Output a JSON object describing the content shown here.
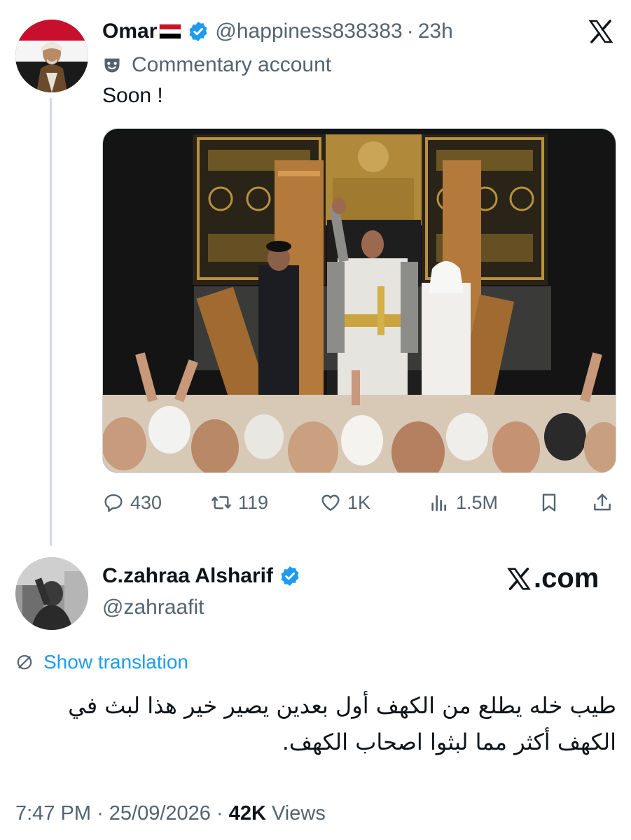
{
  "tweet1": {
    "display_name": "Omar",
    "handle": "@happiness838383",
    "time": "23h",
    "label": "Commentary account",
    "text": "Soon !",
    "flag_icon": "yemen-flag-icon",
    "stats": {
      "replies": "430",
      "reposts": "119",
      "likes": "1K",
      "views": "1.5M"
    }
  },
  "tweet2": {
    "display_name": "C.zahraa Alsharif",
    "handle": "@zahraafit",
    "brand": ".com",
    "translate_label": "Show translation",
    "text": "طيب خله يطلع من الكهف أول بعدين يصير خير هذا لبث في الكهف أكثر مما لبثوا اصحاب الكهف.",
    "time": "7:47 PM",
    "date": "25/09/2026",
    "views_count": "42K",
    "views_label": "Views"
  },
  "colors": {
    "accent": "#1d9bf0",
    "secondary_text": "#536471",
    "primary_text": "#0f1419",
    "thread_line": "#cfd9de"
  }
}
